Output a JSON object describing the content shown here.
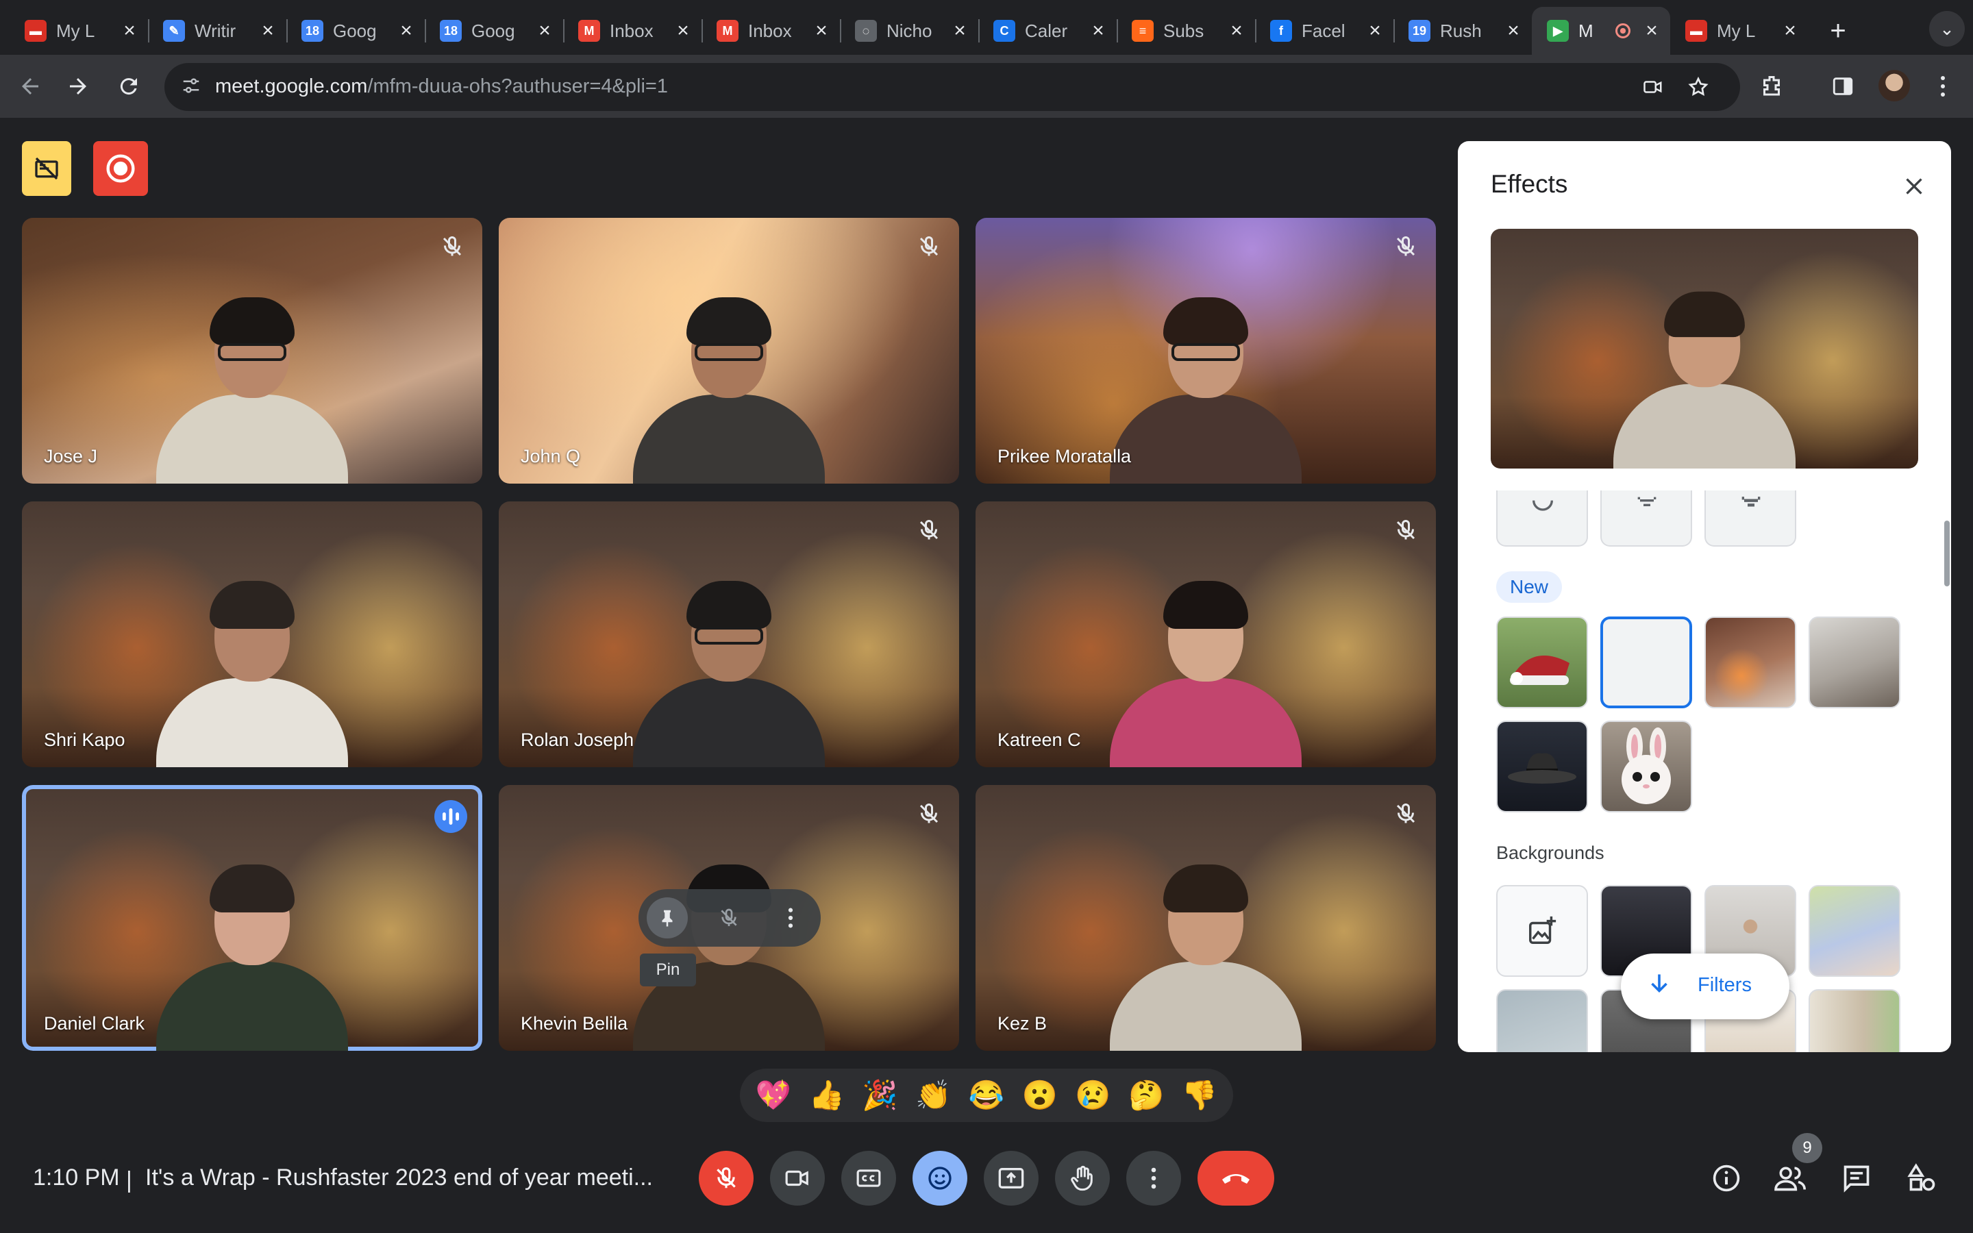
{
  "browser": {
    "tabs": [
      {
        "title": "My L",
        "favicon_color": "#d93025",
        "favicon": "▬"
      },
      {
        "title": "Writir",
        "favicon_color": "#4285f4",
        "favicon": "✎"
      },
      {
        "title": "Goog",
        "favicon_color": "#4285f4",
        "favicon": "18"
      },
      {
        "title": "Goog",
        "favicon_color": "#4285f4",
        "favicon": "18"
      },
      {
        "title": "Inbox",
        "favicon_color": "#ea4335",
        "favicon": "M"
      },
      {
        "title": "Inbox",
        "favicon_color": "#ea4335",
        "favicon": "M"
      },
      {
        "title": "Nicho",
        "favicon_color": "#5f6368",
        "favicon": "◌"
      },
      {
        "title": "Caler",
        "favicon_color": "#1a73e8",
        "favicon": "C"
      },
      {
        "title": "Subs",
        "favicon_color": "#ff6719",
        "favicon": "≡"
      },
      {
        "title": "Facel",
        "favicon_color": "#1877f2",
        "favicon": "f"
      },
      {
        "title": "Rush",
        "favicon_color": "#4285f4",
        "favicon": "19"
      },
      {
        "title": "M",
        "favicon_color": "#34a853",
        "favicon": "▶",
        "active": true
      },
      {
        "title": "My L",
        "favicon_color": "#d93025",
        "favicon": "▬"
      }
    ],
    "url_host": "meet.google.com",
    "url_path": "/mfm-duua-ohs?authuser=4&pli=1"
  },
  "participants": [
    {
      "name": "Jose J",
      "bg": "cabin",
      "muted": true,
      "skin": "#b9876a",
      "hair": "#1a1614",
      "shirt": "#d8d2c4",
      "glasses": true
    },
    {
      "name": "John Q",
      "bg": "paris",
      "muted": true,
      "skin": "#a9785b",
      "hair": "#1f1d1c",
      "shirt": "#3a3836",
      "glasses": true
    },
    {
      "name": "Prikee Moratalla",
      "bg": "street",
      "muted": true,
      "skin": "#c6977a",
      "hair": "#2a1c16",
      "shirt": "#4a3630",
      "glasses": true
    },
    {
      "name": "Shri Kapo",
      "bg": "xmas",
      "muted": false,
      "skin": "#b4846a",
      "hair": "#2b2420",
      "shirt": "#e6e2da",
      "glasses": false
    },
    {
      "name": "Rolan Joseph",
      "bg": "xmas",
      "muted": true,
      "skin": "#a87a5e",
      "hair": "#1c1a19",
      "shirt": "#2c2c2e",
      "glasses": true
    },
    {
      "name": "Katreen C",
      "bg": "xmas",
      "muted": true,
      "skin": "#d3a88c",
      "hair": "#1a1412",
      "shirt": "#c2456e",
      "glasses": false
    },
    {
      "name": "Daniel Clark",
      "bg": "xmas",
      "muted": false,
      "speaking": true,
      "skin": "#d3a48d",
      "hair": "#2c2420",
      "shirt": "#2e3a2e",
      "glasses": false
    },
    {
      "name": "Khevin Belila",
      "bg": "xmas",
      "muted": true,
      "skin": "#a47758",
      "hair": "#151313",
      "shirt": "#3b3026",
      "glasses": false
    },
    {
      "name": "Kez B",
      "bg": "xmas",
      "muted": true,
      "skin": "#c99a7c",
      "hair": "#2a1f18",
      "shirt": "#c9c2b6",
      "glasses": false
    }
  ],
  "tile_hover": {
    "pin_tooltip": "Pin"
  },
  "effects": {
    "title": "Effects",
    "new_label": "New",
    "backgrounds_label": "Backgrounds",
    "filters_label": "Filters"
  },
  "reactions": [
    "💖",
    "👍",
    "🎉",
    "👏",
    "😂",
    "😮",
    "😢",
    "🤔",
    "👎"
  ],
  "meeting": {
    "time": "1:10 PM",
    "separator": "|",
    "title": "It's a Wrap - Rushfaster 2023 end of year meeti...",
    "people_count": "9"
  },
  "colors": {
    "accent": "#8ab4f8",
    "danger": "#ea4335",
    "surface": "#3c4043"
  }
}
